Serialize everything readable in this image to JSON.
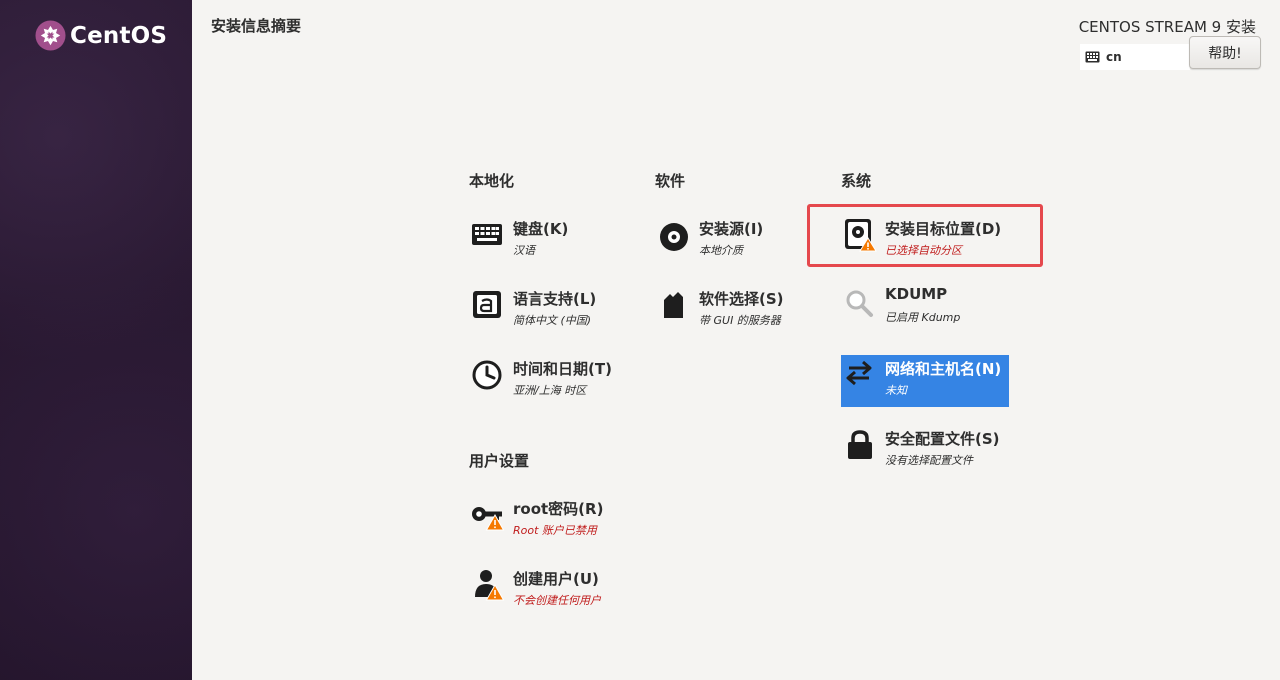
{
  "brand": {
    "name": "CentOS"
  },
  "header": {
    "title": "安装信息摘要",
    "product": "CENTOS STREAM 9 安装",
    "keyboard_layout": "cn",
    "help_label": "帮助!"
  },
  "sections": {
    "localization": "本地化",
    "software": "软件",
    "system": "系统",
    "user_settings": "用户设置"
  },
  "spokes": {
    "keyboard": {
      "title": "键盘(K)",
      "status": "汉语",
      "icon": "keyboard-icon"
    },
    "language": {
      "title": "语言支持(L)",
      "status": "简体中文 (中国)",
      "icon": "language-icon"
    },
    "datetime": {
      "title": "时间和日期(T)",
      "status": "亚洲/上海 时区",
      "icon": "clock-icon"
    },
    "source": {
      "title": "安装源(I)",
      "status": "本地介质",
      "icon": "disc-icon"
    },
    "software_selection": {
      "title": "软件选择(S)",
      "status": "带 GUI 的服务器",
      "icon": "package-icon"
    },
    "storage": {
      "title": "安装目标位置(D)",
      "status": "已选择自动分区",
      "icon": "harddisk-warning-icon"
    },
    "kdump": {
      "title": "KDUMP",
      "status": "已启用 Kdump",
      "icon": "magnifier-icon"
    },
    "network": {
      "title": "网络和主机名(N)",
      "status": "未知",
      "icon": "network-arrows-icon"
    },
    "security": {
      "title": "安全配置文件(S)",
      "status": "没有选择配置文件",
      "icon": "lock-icon"
    },
    "root_password": {
      "title": "root密码(R)",
      "status": "Root 账户已禁用",
      "icon": "key-warning-icon"
    },
    "user_creation": {
      "title": "创建用户(U)",
      "status": "不会创建任何用户",
      "icon": "user-warning-icon"
    }
  },
  "colors": {
    "accent": "#3584e4",
    "warning": "#c01c1c",
    "highlight": "#e5484d",
    "sidebar": "#2a1a33"
  }
}
